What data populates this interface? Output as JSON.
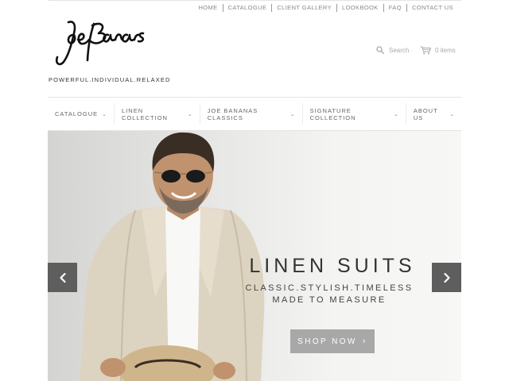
{
  "top_nav": [
    "HOME",
    "CATALOGUE",
    "CLIENT GALLERY",
    "LOOKBOOK",
    "FAQ",
    "CONTACT US"
  ],
  "brand": {
    "logo_text": "JoeBananas",
    "tagline": "POWERFUL.INDIVIDUAL.RELAXED"
  },
  "header": {
    "search_label": "Search",
    "search_icon": "search-icon",
    "cart_label": "0 items",
    "cart_icon": "cart-icon"
  },
  "main_nav": [
    {
      "label": "CATALOGUE",
      "icon": "chevron-down-icon"
    },
    {
      "label": "LINEN COLLECTION",
      "icon": "chevron-down-icon"
    },
    {
      "label": "JOE BANANAS CLASSICS",
      "icon": "chevron-down-icon"
    },
    {
      "label": "SIGNATURE COLLECTION",
      "icon": "chevron-down-icon"
    },
    {
      "label": "ABOUT US",
      "icon": "chevron-down-icon"
    }
  ],
  "hero": {
    "title": "LINEN SUITS",
    "subtitle_1": "CLASSIC.STYLISH.TIMELESS",
    "subtitle_2": "MADE TO MEASURE",
    "button_label": "SHOP NOW",
    "prev_icon": "chevron-left-icon",
    "next_icon": "chevron-right-icon"
  },
  "colors": {
    "arrow_bg": "#5e5e5e",
    "button_bg": "#a8a8a8",
    "text_dark": "#333333",
    "border": "#e4e4e4"
  }
}
